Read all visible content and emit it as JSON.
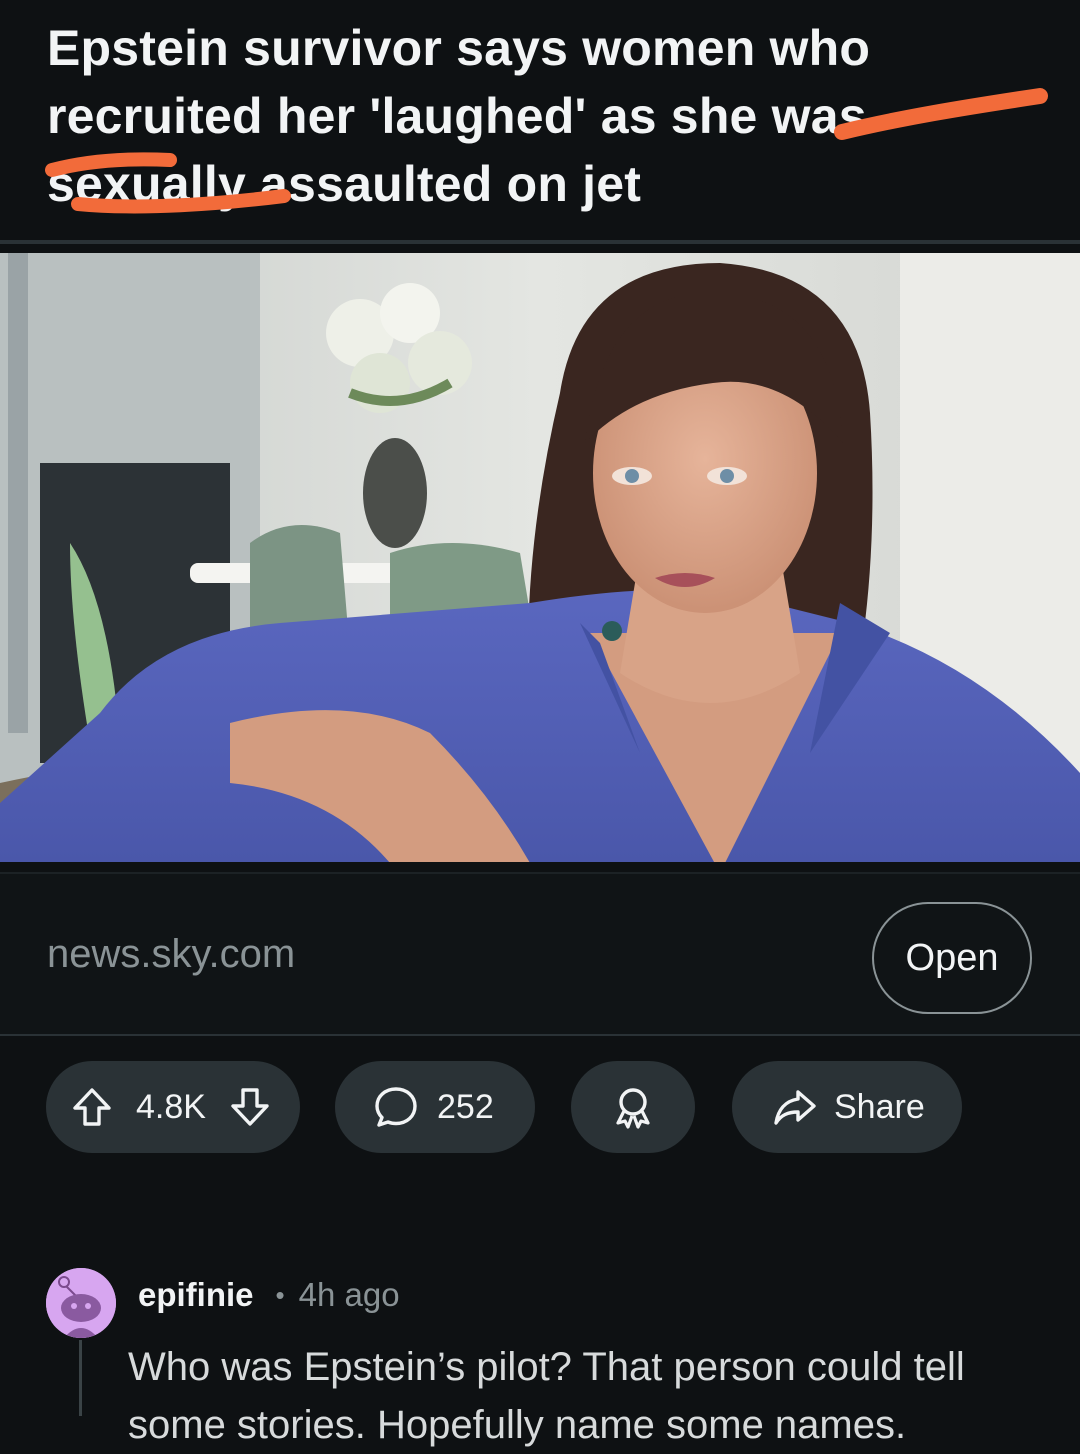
{
  "post": {
    "title": "Epstein survivor says women who recruited her 'laughed' as she was sexually assaulted on jet",
    "image_alt": "woman-in-blue-shirt-interview-photo",
    "link_domain": "news.sky.com",
    "open_label": "Open"
  },
  "actions": {
    "upvote_icon": "arrow-up-icon",
    "score": "4.8K",
    "downvote_icon": "arrow-down-icon",
    "comment_icon": "speech-bubble-icon",
    "comment_count": "252",
    "award_icon": "award-ribbon-icon",
    "share_icon": "share-arrow-icon",
    "share_label": "Share"
  },
  "comment": {
    "author": "epifinie",
    "separator": "•",
    "time": "4h ago",
    "body": "Who was Epstein’s pilot? That person could tell some stories. Hopefully name some names."
  },
  "colors": {
    "background": "#0e1113",
    "pill": "#2a3236",
    "text": "#f2f4f5",
    "muted": "#8a9396",
    "scribble": "#f26b3a",
    "avatar": "#d7a6f0",
    "shirt": "#5563b8"
  }
}
